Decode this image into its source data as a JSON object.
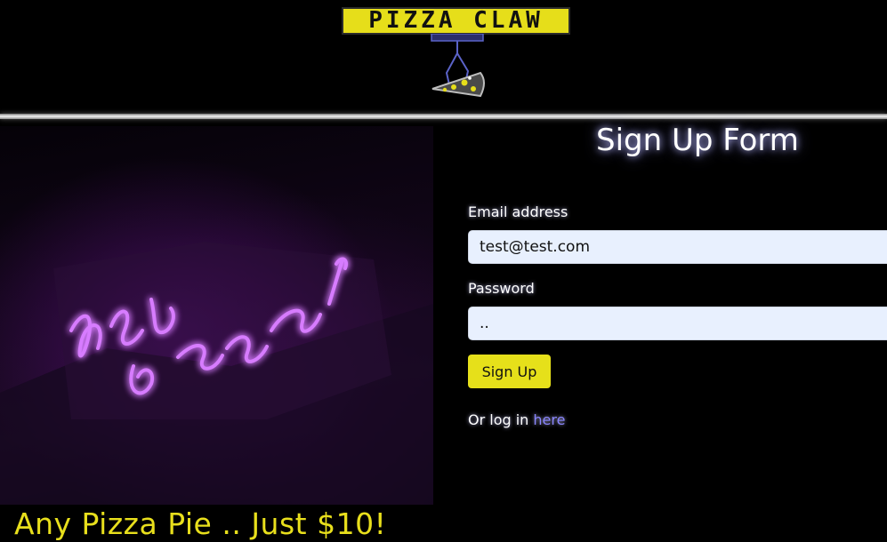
{
  "header": {
    "logo_text": "PIZZA CLAW",
    "brand_color": "#e6de1a"
  },
  "hero": {
    "promo_text": "Any Pizza Pie .. Just $10!"
  },
  "form": {
    "title": "Sign Up Form",
    "email_label": "Email address",
    "email_value": "test@test.com",
    "password_label": "Password",
    "password_value": "..",
    "submit_label": "Sign Up",
    "login_prefix": "Or log in ",
    "login_link_text": "here"
  },
  "colors": {
    "background": "#000000",
    "accent_yellow": "#e6e01a",
    "link": "#8a86ff",
    "input_bg": "#e8f0fe"
  }
}
